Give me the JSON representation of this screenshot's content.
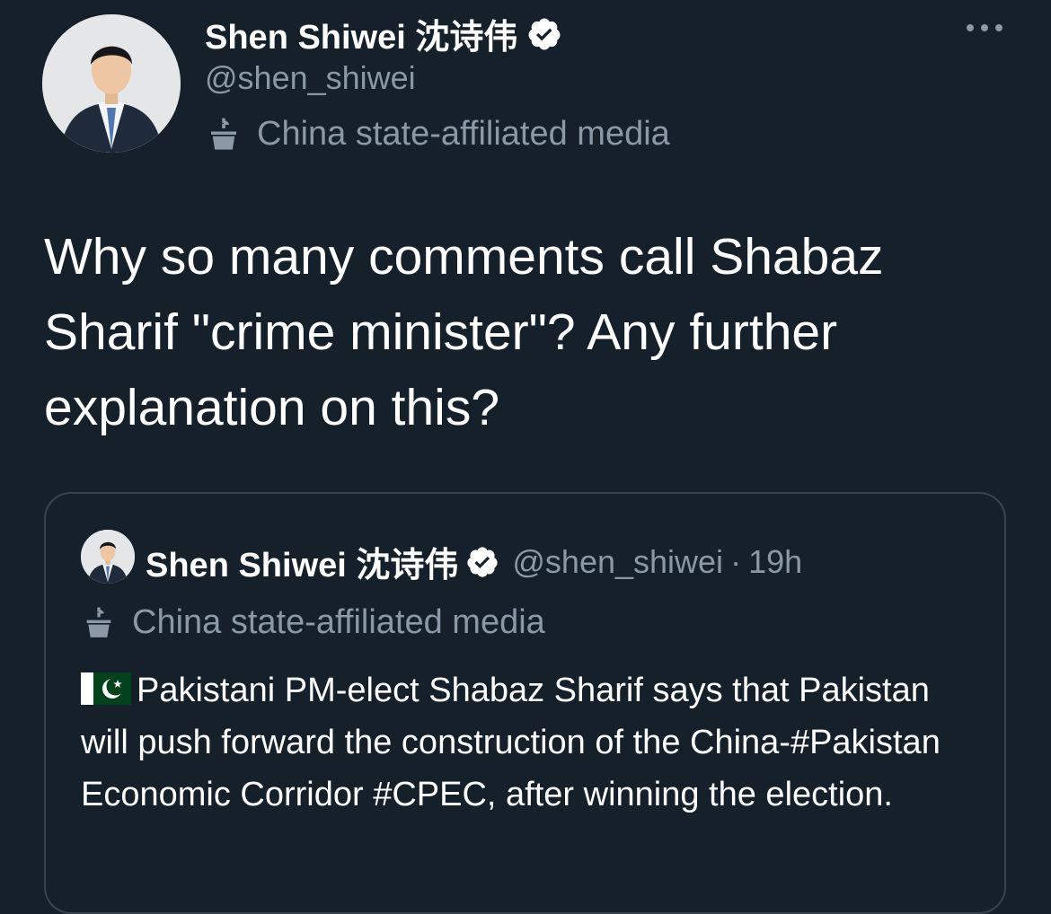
{
  "tweet": {
    "author": {
      "display_name": "Shen Shiwei 沈诗伟",
      "handle": "@shen_shiwei",
      "verified_icon": "verified-badge-icon",
      "affiliation_label": "China state-affiliated media",
      "affiliation_icon": "podium-icon"
    },
    "more_icon": "more-options-icon",
    "text": "Why so many comments call Shabaz Sharif \"crime minister\"? Any further explanation on this?"
  },
  "quoted_tweet": {
    "author": {
      "display_name": "Shen Shiwei 沈诗伟",
      "handle": "@shen_shiwei",
      "verified_icon": "verified-badge-icon",
      "affiliation_label": "China state-affiliated media",
      "affiliation_icon": "podium-icon"
    },
    "separator": "·",
    "timestamp": "19h",
    "flag_icon": "pakistan-flag-icon",
    "text": "Pakistani PM-elect Shabaz Sharif says that Pakistan will push forward the construction of the China-#Pakistan Economic Corridor #CPEC, after winning the election."
  },
  "colors": {
    "background": "#15202b",
    "primary_text": "#ffffff",
    "secondary_text": "#8b98a5",
    "border": "#38444d"
  }
}
